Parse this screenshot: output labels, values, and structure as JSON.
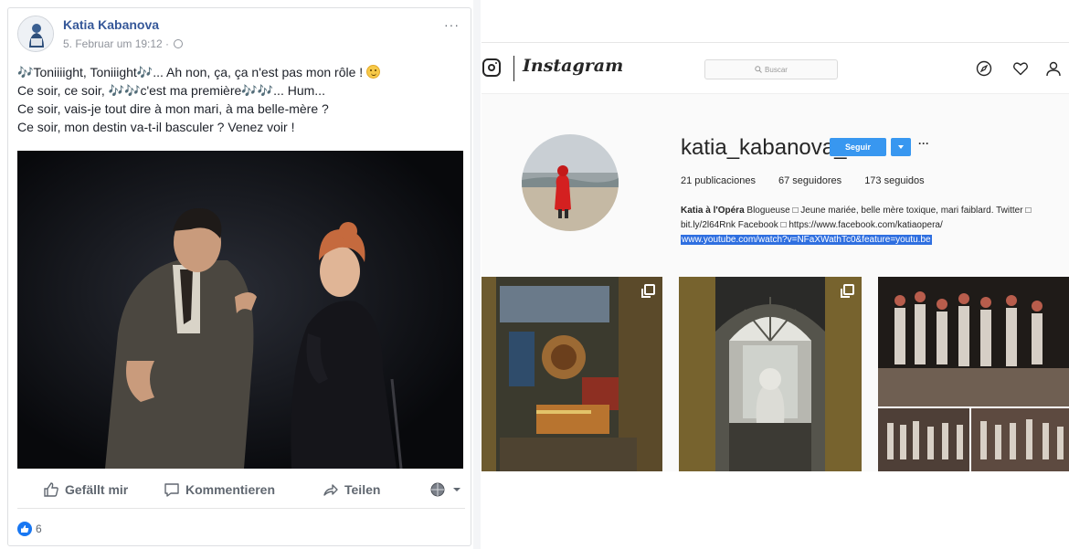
{
  "facebook": {
    "author": "Katia Kabanova",
    "date": "5. Februar um 19:12 ·",
    "more": "···",
    "lines": [
      {
        "note1": "🎶",
        "text": "Toniiiight, Toniiight",
        "note2": "🎶",
        "rest": "... Ah non, ça, ça n'est pas mon rôle !"
      },
      {
        "pre": "Ce soir, ce soir, ",
        "note": "🎶🎶",
        "text": "c'est ma première",
        "note2": "🎶🎶",
        "rest": "... Hum..."
      },
      {
        "text": "Ce soir, vais-je tout dire à mon mari, à ma belle-mère ?"
      },
      {
        "text": "Ce soir, mon destin va-t-il basculer ? Venez voir !"
      }
    ],
    "actions": {
      "like": "Gefällt mir",
      "comment": "Kommentieren",
      "share": "Teilen"
    },
    "reactions_count": "6"
  },
  "instagram": {
    "brand": "Instagram",
    "search_placeholder": "Buscar",
    "username": "katia_kabanova_",
    "follow_label": "Seguir",
    "more": "···",
    "stats": {
      "posts": "21 publicaciones",
      "followers": "67 seguidores",
      "following": "173 seguidos"
    },
    "bio": {
      "name": "Katia à l'Opéra",
      "text1": " Blogueuse □ Jeune mariée, belle mère toxique, mari faiblard. Twitter □",
      "text2": "bit.ly/2l64Rnk Facebook □ https://www.facebook.com/katiaopera/",
      "link": "www.youtube.com/watch?v=NFaXWathTc0&feature=youtu.be"
    }
  },
  "colors": {
    "fb_blue": "#365899",
    "ig_blue": "#3897f0",
    "link_highlight": "#2f6fe0"
  }
}
